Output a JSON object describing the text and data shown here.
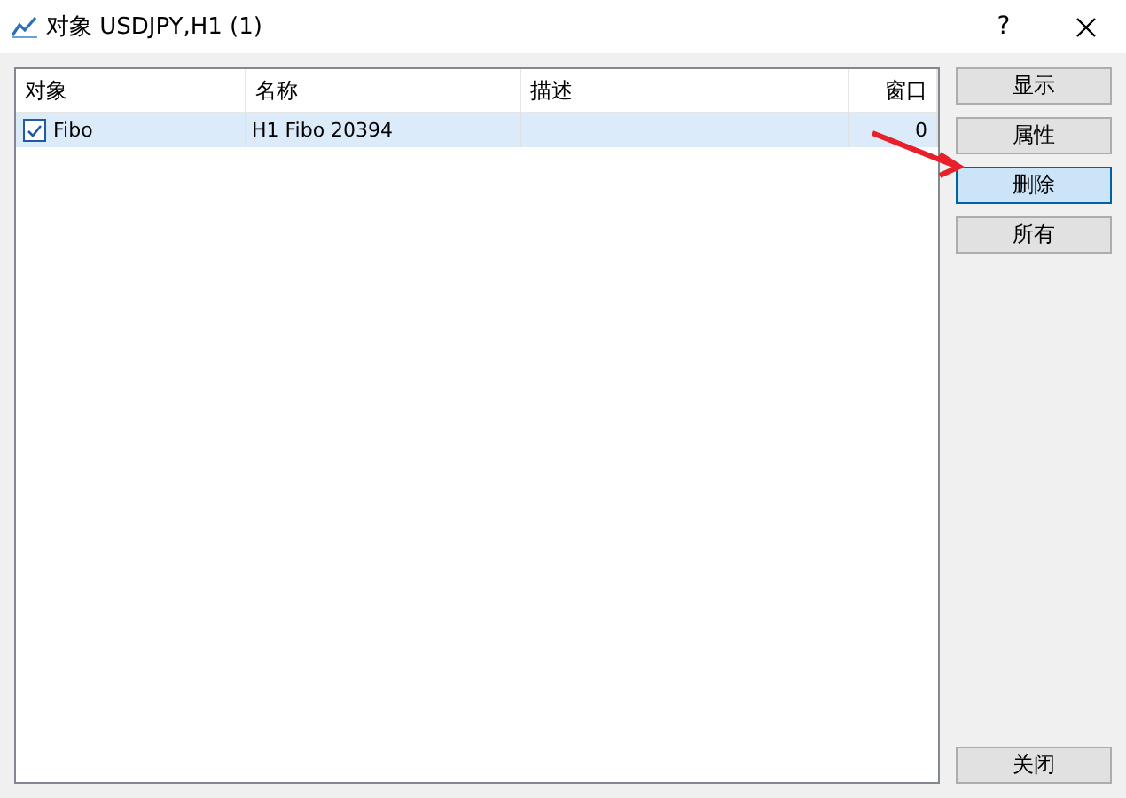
{
  "window": {
    "title": "对象 USDJPY,H1 (1)",
    "help": "?"
  },
  "table": {
    "columns": [
      "对象",
      "名称",
      "描述",
      "窗口"
    ],
    "rows": [
      {
        "cells": [
          "Fibo",
          "H1 Fibo 20394",
          "",
          "0"
        ],
        "checked": true,
        "selected": true
      }
    ]
  },
  "buttons": [
    {
      "label": "显示",
      "selected": false
    },
    {
      "label": "属性",
      "selected": false
    },
    {
      "label": "删除",
      "selected": true
    },
    {
      "label": "所有",
      "selected": false
    }
  ],
  "close_button": "关闭"
}
